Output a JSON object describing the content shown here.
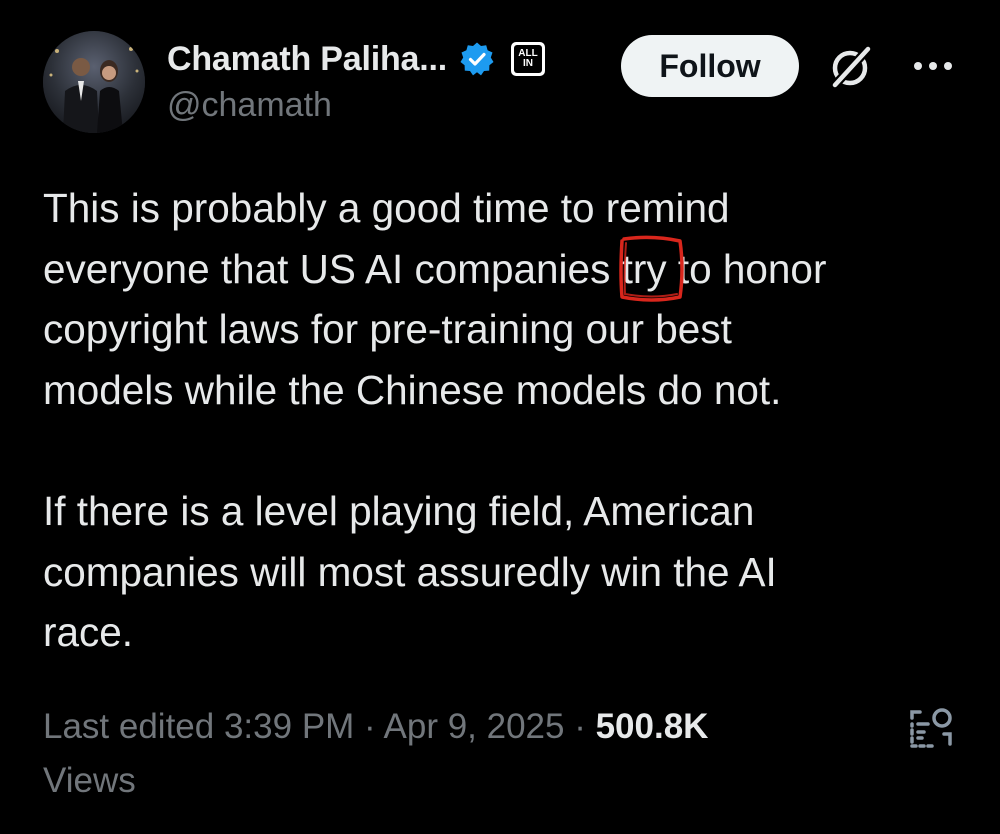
{
  "author": {
    "display_name": "Chamath Paliha...",
    "handle": "@chamath",
    "verified_badge_color": "#1d9bf0",
    "affiliation_badge": {
      "line1": "ALL",
      "line2": "IN"
    },
    "avatar_icon": "profile-photo"
  },
  "actions": {
    "follow_label": "Follow",
    "grok_icon": "grok-slash-icon",
    "more_icon": "more-horizontal-icon"
  },
  "tweet": {
    "paragraph1": {
      "line1": "This is probably a good time to remind",
      "line2_before": "everyone that US AI companies ",
      "line2_circled": "try",
      "line2_after": " to honor",
      "line3": "copyright laws for pre-training our best",
      "line4": "models while the Chinese models do not."
    },
    "paragraph2": {
      "line1": "If there is a level playing field, American",
      "line2": "companies will most assuredly win the AI",
      "line3": "race."
    },
    "annotation_color": "#d9261c"
  },
  "meta": {
    "edited_prefix": "Last edited ",
    "time": "3:39 PM",
    "separator": " · ",
    "date": "Apr 9, 2025",
    "views_count": "500.8K",
    "views_label": "Views",
    "analytics_icon": "analytics-icon"
  }
}
